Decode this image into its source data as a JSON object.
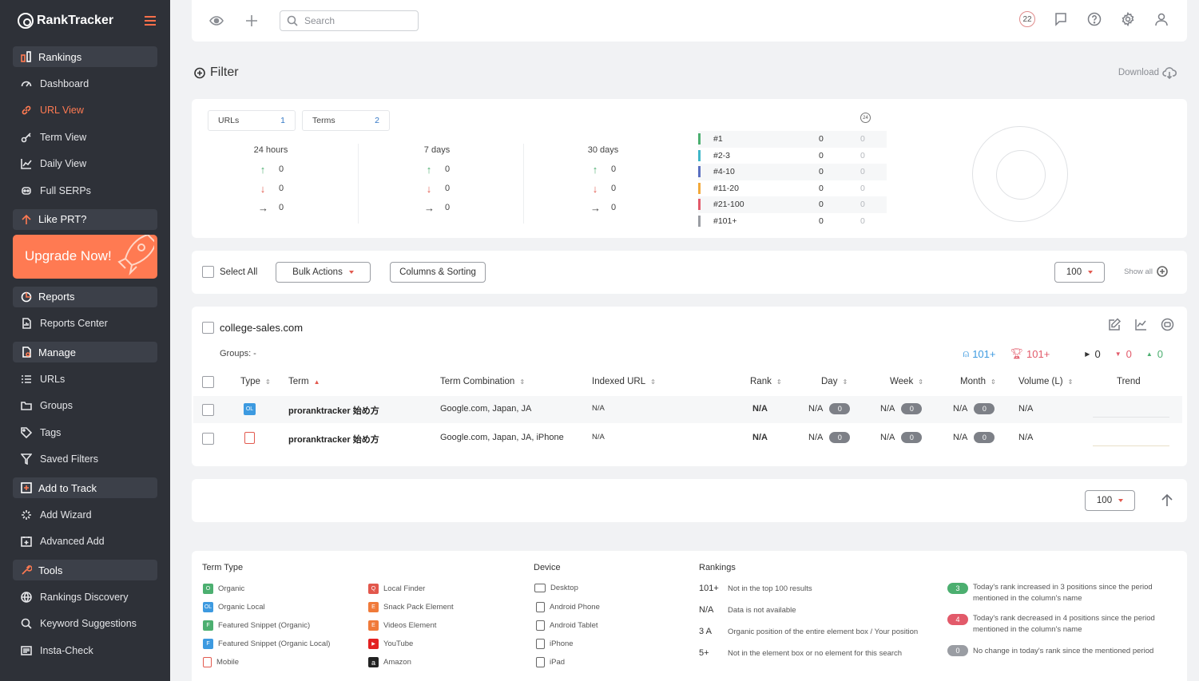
{
  "app": {
    "name": "RankTracker"
  },
  "sidebar": {
    "rankings_section": "Rankings",
    "rankings_items": [
      "Dashboard",
      "URL View",
      "Term View",
      "Daily View",
      "Full SERPs"
    ],
    "like_label": "Like PRT?",
    "upgrade_label": "Upgrade Now!",
    "reports_section": "Reports",
    "reports_items": [
      "Reports Center"
    ],
    "manage_section": "Manage",
    "manage_items": [
      "URLs",
      "Groups",
      "Tags",
      "Saved Filters"
    ],
    "add_section": "Add to Track",
    "add_items": [
      "Add Wizard",
      "Advanced Add"
    ],
    "tools_section": "Tools",
    "tools_items": [
      "Rankings Discovery",
      "Keyword Suggestions",
      "Insta-Check"
    ],
    "accent_color": "#ff7a52"
  },
  "topbar": {
    "search_placeholder": "Search",
    "notification_count": "22"
  },
  "filter": {
    "title": "Filter",
    "download_label": "Download"
  },
  "summary": {
    "urls_label": "URLs",
    "urls_count": "1",
    "terms_label": "Terms",
    "terms_count": "2",
    "periods": [
      {
        "label": "24 hours",
        "up": "0",
        "down": "0",
        "same": "0"
      },
      {
        "label": "7 days",
        "up": "0",
        "down": "0",
        "same": "0"
      },
      {
        "label": "30 days",
        "up": "0",
        "down": "0",
        "same": "0"
      }
    ],
    "refresh_label": "24",
    "ranks": [
      {
        "label": "#1",
        "v1": "0",
        "v2": "0",
        "color": "#4caf70"
      },
      {
        "label": "#2-3",
        "v1": "0",
        "v2": "0",
        "color": "#3fb6c8"
      },
      {
        "label": "#4-10",
        "v1": "0",
        "v2": "0",
        "color": "#5a6fc0"
      },
      {
        "label": "#11-20",
        "v1": "0",
        "v2": "0",
        "color": "#f2a93b"
      },
      {
        "label": "#21-100",
        "v1": "0",
        "v2": "0",
        "color": "#e25a6a"
      },
      {
        "label": "#101+",
        "v1": "0",
        "v2": "0",
        "color": "#9a9da3"
      }
    ]
  },
  "toolbar": {
    "select_all": "Select All",
    "bulk_actions": "Bulk Actions",
    "columns_sorting": "Columns & Sorting",
    "page_size": "100",
    "show_all": "Show all"
  },
  "table": {
    "domain": "college-sales.com",
    "groups": "Groups: -",
    "stat_up": "101+",
    "stat_trophy": "101+",
    "stat_same": "0",
    "stat_down": "0",
    "stat_rise": "0",
    "headers": {
      "type": "Type",
      "term": "Term",
      "combination": "Term Combination",
      "indexed_url": "Indexed URL",
      "rank": "Rank",
      "day": "Day",
      "week": "Week",
      "month": "Month",
      "volume": "Volume (L)",
      "trend": "Trend"
    },
    "rows": [
      {
        "type_icon": "organic-local-icon",
        "term": "proranktracker 始め方",
        "combination": "Google.com, Japan, JA",
        "indexed_url": "N/A",
        "rank": "N/A",
        "day": "N/A",
        "day_change": "0",
        "week": "N/A",
        "week_change": "0",
        "month": "N/A",
        "month_change": "0",
        "volume": "N/A"
      },
      {
        "type_icon": "mobile-icon",
        "term": "proranktracker 始め方",
        "combination": "Google.com, Japan, JA, iPhone",
        "indexed_url": "N/A",
        "rank": "N/A",
        "day": "N/A",
        "day_change": "0",
        "week": "N/A",
        "week_change": "0",
        "month": "N/A",
        "month_change": "0",
        "volume": "N/A"
      }
    ]
  },
  "pager": {
    "page_size": "100"
  },
  "legend": {
    "term_type_title": "Term Type",
    "term_types_col1": [
      {
        "label": "Organic",
        "color": "#4caf70",
        "glyph": "O"
      },
      {
        "label": "Organic Local",
        "color": "#3d9ae0",
        "glyph": "OL"
      },
      {
        "label": "Featured Snippet (Organic)",
        "color": "#4caf70",
        "glyph": "F"
      },
      {
        "label": "Featured Snippet (Organic Local)",
        "color": "#3d9ae0",
        "glyph": "F"
      },
      {
        "label": "Mobile",
        "color": "#ffffff",
        "glyph": ""
      }
    ],
    "term_types_col2": [
      {
        "label": "Local Finder",
        "color": "#e2574c",
        "glyph": "Q"
      },
      {
        "label": "Snack Pack Element",
        "color": "#f07a3a",
        "glyph": "E"
      },
      {
        "label": "Videos Element",
        "color": "#f07a3a",
        "glyph": "E"
      },
      {
        "label": "YouTube",
        "color": "#e32020",
        "glyph": "▶"
      },
      {
        "label": "Amazon",
        "color": "#222222",
        "glyph": "a"
      }
    ],
    "device_title": "Device",
    "devices": [
      "Desktop",
      "Android Phone",
      "Android Tablet",
      "iPhone",
      "iPad"
    ],
    "rankings_title": "Rankings",
    "rankings": [
      {
        "key": "101+",
        "text": "Not in the top 100 results"
      },
      {
        "key": "N/A",
        "text": "Data is not available"
      },
      {
        "key": "3 A",
        "text": "Organic position of the entire element box / Your position"
      },
      {
        "key": "5+",
        "text": "Not in the element box or no element for this search"
      }
    ],
    "changes": [
      {
        "badge": "3",
        "color": "#4caf70",
        "line1": "Today's rank increased in 3 positions since the period",
        "line2": "mentioned in the column's name"
      },
      {
        "badge": "4",
        "color": "#e25a6a",
        "line1": "Today's rank decreased in 4 positions since the period",
        "line2": "mentioned in the column's name"
      },
      {
        "badge": "0",
        "color": "#9a9da3",
        "line1": "No change in today's rank since the mentioned period",
        "line2": ""
      }
    ]
  }
}
